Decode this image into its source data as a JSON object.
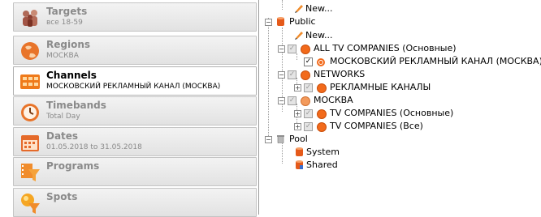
{
  "sections": [
    {
      "title": "Targets",
      "subtitle": "все 18-59",
      "icon": "people-icon",
      "active": false
    },
    {
      "title": "Regions",
      "subtitle": "МОСКВА",
      "icon": "globe-icon",
      "active": false
    },
    {
      "title": "Channels",
      "subtitle": "МОСКОВСКИЙ РЕКЛАМНЫЙ КАНАЛ (МОСКВА)",
      "icon": "channels-icon",
      "active": true
    },
    {
      "title": "Timebands",
      "subtitle": "Total Day",
      "icon": "clock-icon",
      "active": false
    },
    {
      "title": "Dates",
      "subtitle": "01.05.2018 to 31.05.2018",
      "icon": "calendar-icon",
      "active": false
    },
    {
      "title": "Programs",
      "subtitle": "",
      "icon": "film-funnel-icon",
      "active": false
    },
    {
      "title": "Spots",
      "subtitle": "",
      "icon": "spots-funnel-icon",
      "active": false
    }
  ],
  "tree": {
    "new_top": "New...",
    "public": "Public",
    "public_new": "New...",
    "all_tv": "ALL TV COMPANIES (Основные)",
    "mrk": "МОСКОВСКИЙ РЕКЛАМНЫЙ КАНАЛ (МОСКВА)",
    "networks": "NETWORKS",
    "ad_channels": "РЕКЛАМНЫЕ КАНАЛЫ",
    "moskva": "МОСКВА",
    "tv_main": "TV COMPANIES (Основные)",
    "tv_all": "TV COMPANIES (Все)",
    "pool": "Pool",
    "system": "System",
    "shared": "Shared"
  },
  "colors": {
    "accent": "#f26a1b",
    "selected_bg": "#ffffff"
  }
}
